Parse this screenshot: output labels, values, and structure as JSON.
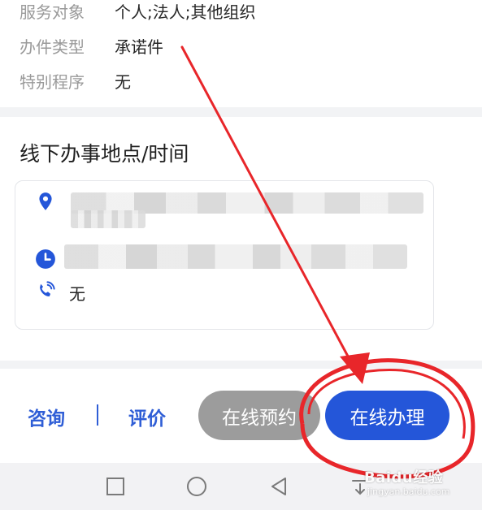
{
  "details": {
    "rows": [
      {
        "label": "服务对象",
        "value": "个人;法人;其他组织"
      },
      {
        "label": "办件类型",
        "value": "承诺件"
      },
      {
        "label": "特别程序",
        "value": "无"
      }
    ]
  },
  "offline": {
    "title": "线下办事地点/时间",
    "phone_value": "无",
    "icons": {
      "location": "location-pin-icon",
      "time": "clock-icon",
      "phone": "phone-icon"
    }
  },
  "actions": {
    "consult_label": "咨询",
    "review_label": "评价",
    "reserve_label": "在线预约",
    "apply_label": "在线办理"
  },
  "colors": {
    "accent": "#2456d9",
    "link": "#2f5ed6",
    "disabled": "#9c9c9c",
    "annotation": "#e8262a"
  },
  "watermark": {
    "brand": "Baidu经验",
    "url": "jingyan.baidu.com"
  }
}
